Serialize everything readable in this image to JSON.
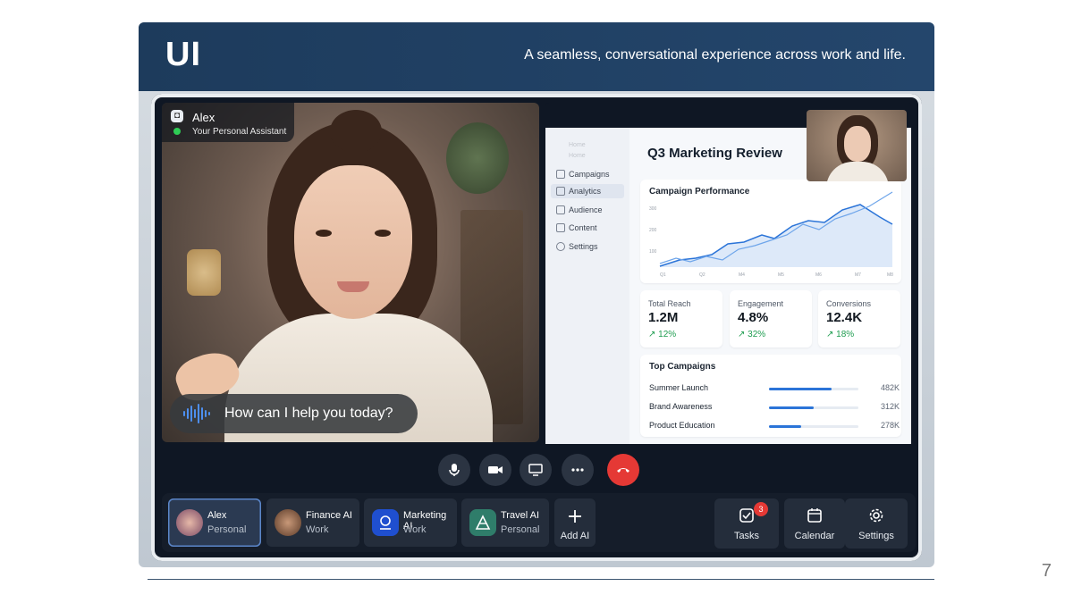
{
  "banner": {
    "logo": "UI",
    "tagline": "A seamless, conversational experience across work and life."
  },
  "page_number": "7",
  "caller": {
    "name": "Alex",
    "role": "Your Personal Assistant",
    "status_color": "#2ecc55"
  },
  "speech_bubble": "How can I help you today?",
  "dashboard": {
    "nav": [
      "Campaigns",
      "Analytics",
      "Audience",
      "Content",
      "Settings"
    ],
    "nav_active": "Analytics",
    "nav_muted": [
      "Home",
      "Home"
    ],
    "title": "Q3 Marketing Review",
    "chart_title": "Campaign Performance",
    "chart_y_ticks": [
      "300",
      "200",
      "100"
    ],
    "chart_x_ticks": [
      "Q1",
      "Q2",
      "M4",
      "M5",
      "M6",
      "M7",
      "M8"
    ],
    "kpis": [
      {
        "label": "Total Reach",
        "value": "1.2M",
        "delta": "↗ 12%"
      },
      {
        "label": "Engagement",
        "value": "4.8%",
        "delta": "↗ 32%"
      },
      {
        "label": "Conversions",
        "value": "12.4K",
        "delta": "↗ 18%"
      }
    ],
    "top_campaigns_title": "Top Campaigns",
    "top_campaigns": [
      {
        "name": "Summer Launch",
        "value": "482K",
        "fraction": 0.7
      },
      {
        "name": "Brand Awareness",
        "value": "312K",
        "fraction": 0.5
      },
      {
        "name": "Product Education",
        "value": "278K",
        "fraction": 0.36
      }
    ],
    "accent": "#2b74d8"
  },
  "call_controls": [
    {
      "icon": "microphone-icon"
    },
    {
      "icon": "camera-icon"
    },
    {
      "icon": "screen-share-icon"
    },
    {
      "icon": "more-icon"
    },
    {
      "icon": "end-call-icon",
      "color": "#e53935"
    }
  ],
  "assistants": [
    {
      "name": "Alex",
      "context": "Personal",
      "active": true
    },
    {
      "name": "Finance AI",
      "context": "Work"
    },
    {
      "name": "Marketing AI",
      "context": "Work"
    },
    {
      "name": "Travel AI",
      "context": "Personal"
    }
  ],
  "add_ai_label": "Add AI",
  "utilities": [
    {
      "label": "Tasks",
      "badge": "3",
      "icon": "tasks-icon"
    },
    {
      "label": "Calendar",
      "icon": "calendar-icon"
    },
    {
      "label": "Settings",
      "icon": "gear-icon"
    }
  ]
}
